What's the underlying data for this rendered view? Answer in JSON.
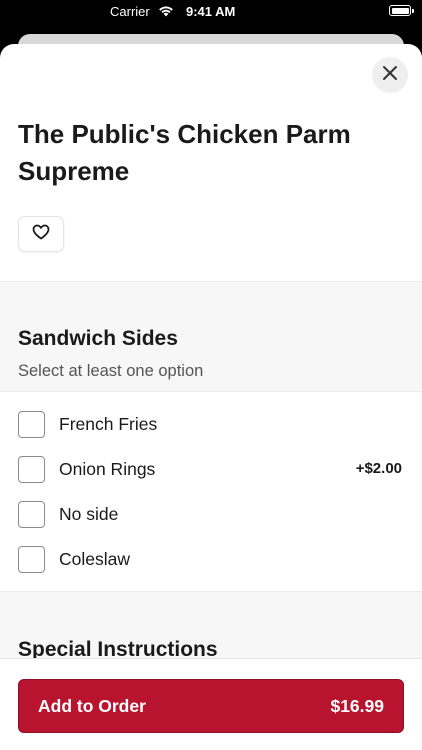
{
  "status_bar": {
    "carrier": "Carrier",
    "time": "9:41 AM",
    "icons": [
      "wifi-icon",
      "battery-icon"
    ]
  },
  "item": {
    "title": "The Public's Chicken Parm Supreme"
  },
  "icons": {
    "close": "close-icon",
    "favorite": "heart-icon"
  },
  "sandwich_sides": {
    "title": "Sandwich Sides",
    "subtitle": "Select at least one option",
    "options": [
      {
        "label": "French Fries",
        "price": "",
        "checked": false
      },
      {
        "label": "Onion Rings",
        "price": "+$2.00",
        "checked": false
      },
      {
        "label": "No side",
        "price": "",
        "checked": false
      },
      {
        "label": "Coleslaw",
        "price": "",
        "checked": false
      }
    ]
  },
  "special_instructions": {
    "title": "Special Instructions"
  },
  "footer": {
    "add_label": "Add to Order",
    "total": "$16.99"
  },
  "colors": {
    "accent": "#b8142f",
    "background": "#ffffff",
    "section_bg": "#f7f7f7"
  }
}
